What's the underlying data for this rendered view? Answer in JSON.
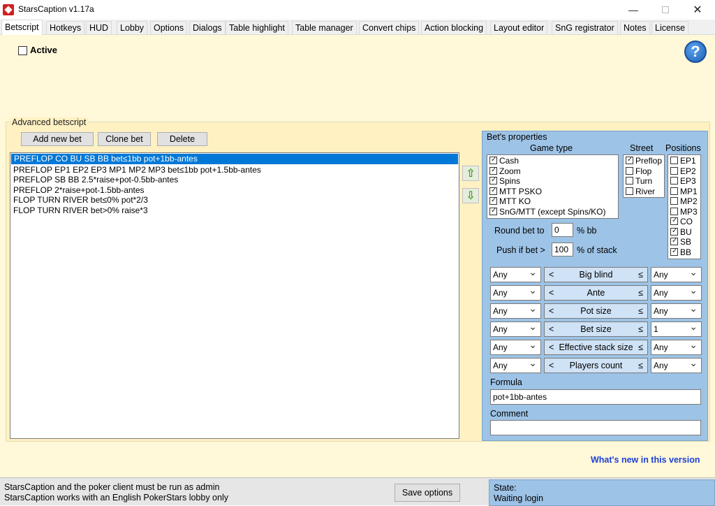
{
  "window": {
    "title": "StarsCaption v1.17a",
    "minimize": "—",
    "close": "✕"
  },
  "tabs": [
    {
      "label": "Betscript"
    },
    {
      "label": "Hotkeys"
    },
    {
      "label": "HUD"
    },
    {
      "label": "Lobby"
    },
    {
      "label": "Options"
    },
    {
      "label": "Dialogs"
    },
    {
      "label": "Table highlight"
    },
    {
      "label": "Table manager"
    },
    {
      "label": "Convert chips"
    },
    {
      "label": "Action blocking"
    },
    {
      "label": "Layout editor"
    },
    {
      "label": "SnG registrator"
    },
    {
      "label": "Notes"
    },
    {
      "label": "License"
    }
  ],
  "active_label": "Active",
  "help_icon": "?",
  "advanced": {
    "title": "Advanced betscript",
    "add_label": "Add new bet",
    "clone_label": "Clone bet",
    "delete_label": "Delete",
    "bets": [
      "PREFLOP CO BU SB BB bet≤1bb pot+1bb-antes",
      "PREFLOP EP1 EP2 EP3 MP1 MP2 MP3 bet≤1bb pot+1.5bb-antes",
      "PREFLOP SB BB 2.5*raise+pot-0.5bb-antes",
      "PREFLOP 2*raise+pot-1.5bb-antes",
      "FLOP TURN RIVER bet≤0% pot*2/3",
      "FLOP TURN RIVER bet>0% raise*3"
    ],
    "up_arrow": "⇧",
    "down_arrow": "⇩"
  },
  "props": {
    "title": "Bet's properties",
    "game_type_header": "Game type",
    "street_header": "Street",
    "positions_header": "Positions",
    "game_types": [
      {
        "label": "Cash",
        "checked": true
      },
      {
        "label": "Zoom",
        "checked": true
      },
      {
        "label": "Spins",
        "checked": true
      },
      {
        "label": "MTT PSKO",
        "checked": true
      },
      {
        "label": "MTT KO",
        "checked": true
      },
      {
        "label": "SnG/MTT (except Spins/KO)",
        "checked": true
      }
    ],
    "streets": [
      {
        "label": "Preflop",
        "checked": true
      },
      {
        "label": "Flop",
        "checked": false
      },
      {
        "label": "Turn",
        "checked": false
      },
      {
        "label": "River",
        "checked": false
      }
    ],
    "positions": [
      {
        "label": "EP1",
        "checked": false
      },
      {
        "label": "EP2",
        "checked": false
      },
      {
        "label": "EP3",
        "checked": false
      },
      {
        "label": "MP1",
        "checked": false
      },
      {
        "label": "MP2",
        "checked": false
      },
      {
        "label": "MP3",
        "checked": false
      },
      {
        "label": "CO",
        "checked": true
      },
      {
        "label": "BU",
        "checked": true
      },
      {
        "label": "SB",
        "checked": true
      },
      {
        "label": "BB",
        "checked": true
      }
    ],
    "round_label": "Round bet to",
    "round_value": "0",
    "round_unit": "% bb",
    "push_label": "Push if bet >",
    "push_value": "100",
    "push_unit": "% of stack",
    "params": [
      {
        "name": "Big blind",
        "left": "Any",
        "right": "Any"
      },
      {
        "name": "Ante",
        "left": "Any",
        "right": "Any"
      },
      {
        "name": "Pot size",
        "left": "Any",
        "right": "Any"
      },
      {
        "name": "Bet size",
        "left": "Any",
        "right": "1"
      },
      {
        "name": "Effective stack size",
        "left": "Any",
        "right": "Any"
      },
      {
        "name": "Players count",
        "left": "Any",
        "right": "Any"
      }
    ],
    "lt": "<",
    "le": "≤",
    "formula_label": "Formula",
    "formula_value": "pot+1bb-antes",
    "comment_label": "Comment",
    "comment_value": ""
  },
  "whats_new": "What's new in this version",
  "status": {
    "line1": "StarsCaption and the poker client must be run as admin",
    "line2": "StarsCaption works with an English PokerStars lobby only",
    "save_label": "Save options",
    "state_label": "State:",
    "state_value": "Waiting login"
  }
}
